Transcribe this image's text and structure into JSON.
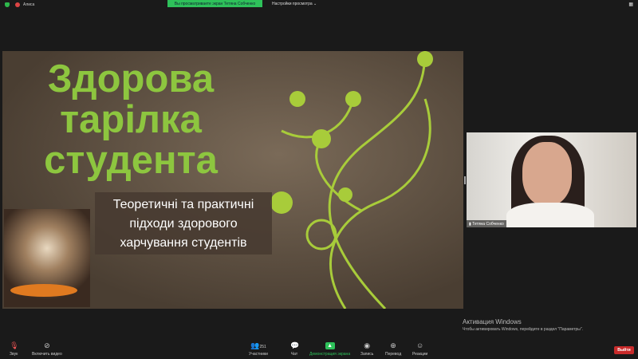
{
  "topbar": {
    "app_label": "Алиса",
    "viewing_banner": "Вы просматриваете экран Тетяна Собченко",
    "view_options": "Настройки просмотра ⌄"
  },
  "slide": {
    "title_lines": [
      "Здорова",
      "тарілка",
      "студента"
    ],
    "subtitle_lines": [
      "Теоретичні та практичні",
      "підходи здорового",
      "харчування студентів"
    ],
    "accent": "#8dc63f"
  },
  "video": {
    "participant_name": "Тетяна Собченко"
  },
  "watermark": {
    "title": "Активация Windows",
    "text": "Чтобы активировать Windows, перейдите в раздел \"Параметры\"."
  },
  "toolbar": {
    "audio": "Звук",
    "video": "Включить видео",
    "participants": "Участники",
    "participants_count": "251",
    "chat": "Чат",
    "share": "Демонстрация экрана",
    "record": "Запись",
    "translate": "Перевод",
    "reactions": "Реакции",
    "leave": "Выйти"
  }
}
